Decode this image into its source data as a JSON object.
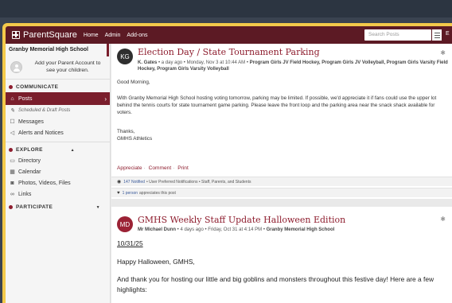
{
  "navbar": {
    "brand": "ParentSquare",
    "links": [
      "Home",
      "Admin",
      "Add-ons"
    ],
    "search_placeholder": "Search Posts",
    "trailing": "E"
  },
  "sidebar": {
    "school": "Granby Memorial High School",
    "parent_account": "Add your Parent Account to see your children.",
    "communicate": {
      "title": "COMMUNICATE",
      "items": [
        {
          "label": "Posts",
          "icon": "home-icon"
        },
        {
          "label": "Scheduled & Draft Posts",
          "icon": "pencil-icon"
        },
        {
          "label": "Messages",
          "icon": "chat-icon"
        },
        {
          "label": "Alerts and Notices",
          "icon": "megaphone-icon"
        }
      ]
    },
    "explore": {
      "title": "EXPLORE",
      "items": [
        {
          "label": "Directory",
          "icon": "folder-icon"
        },
        {
          "label": "Calendar",
          "icon": "calendar-icon"
        },
        {
          "label": "Photos, Videos, Files",
          "icon": "camera-icon"
        },
        {
          "label": "Links",
          "icon": "link-icon"
        }
      ]
    },
    "participate": {
      "title": "PARTICIPATE"
    }
  },
  "posts": [
    {
      "initials": "KG",
      "avatar_color": "#2f2f2f",
      "title": "Election Day / State Tournament Parking",
      "author": "K. Gates",
      "meta": " • a day ago • Monday, Nov 3 at 10:44 AM • ",
      "groups": "Program Girls JV Field Hockey, Program Girls JV Volleyball, Program Girls Varsity Field Hockey, Program Girls Varsity Volleyball",
      "greeting": "Good Morning,",
      "body": "With Granby Memorial High School hosting voting tomorrow, parking may be limited. If possible, we'd appreciate it if fans could use the upper lot behind the tennis courts for state tournament game parking. Please leave the front loop and the parking area near the snack shack available for voters.",
      "thanks": "Thanks,",
      "signature": "GMHS Athletics",
      "actions": [
        "Appreciate",
        "Comment",
        "Print"
      ],
      "notified_count": "147 Notified",
      "notified_rest": " • User Preferred Notifications • Staff, Parents, and Students",
      "appreciates_count": "1 person",
      "appreciates_rest": " appreciates this post"
    },
    {
      "initials": "MD",
      "avatar_color": "#9b2235",
      "title": "GMHS Weekly Staff Update Halloween Edition",
      "author": "Mr Michael Dunn",
      "meta": " • 4 days ago • Friday, Oct 31 at 4:14 PM • ",
      "groups": "Granby Memorial High School",
      "date_line": "10/31/25",
      "greeting": "Happy Halloween, GMHS,",
      "body": "And thank you for hosting our little and big goblins and monsters throughout this festive day! Here are a few highlights:"
    }
  ]
}
